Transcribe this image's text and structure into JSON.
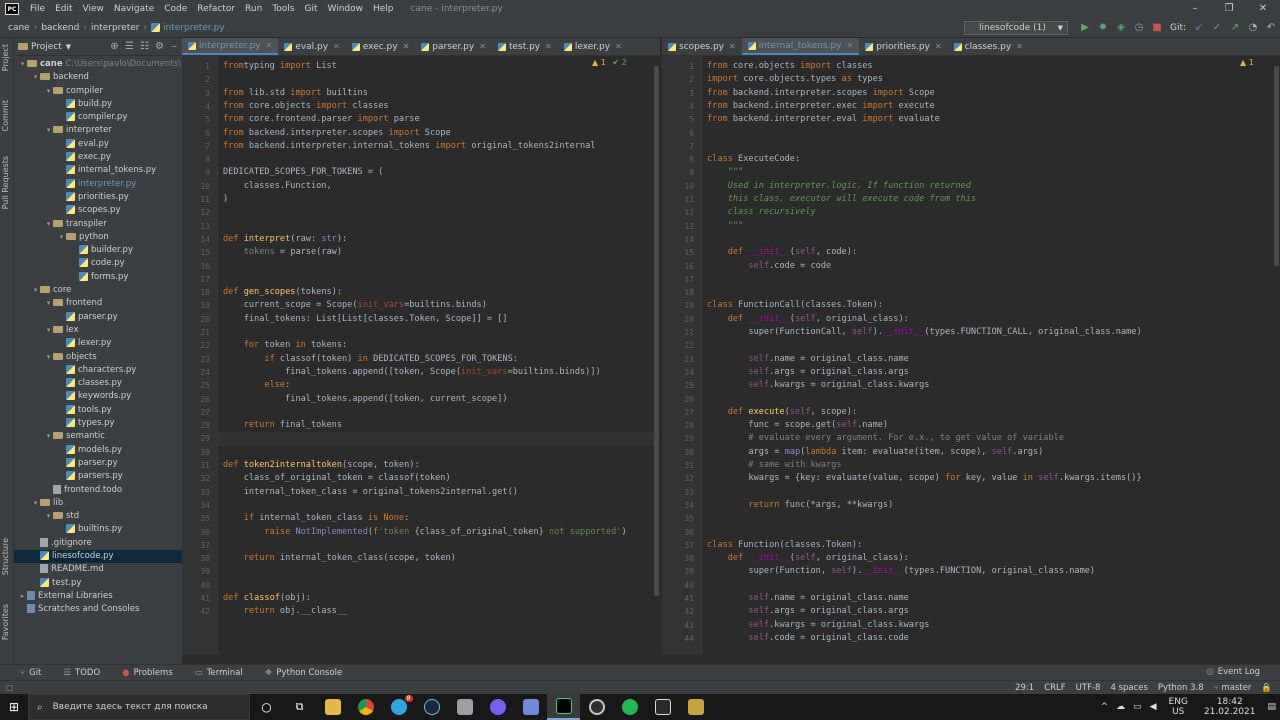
{
  "menu": {
    "items": [
      "File",
      "Edit",
      "View",
      "Navigate",
      "Code",
      "Refactor",
      "Run",
      "Tools",
      "Git",
      "Window",
      "Help"
    ],
    "title": "cane - interpreter.py"
  },
  "breadcrumb": [
    "cane",
    "backend",
    "interpreter",
    "interpreter.py"
  ],
  "run_config": "linesofcode (1)",
  "git_label": "Git:",
  "left_tabs": [
    "Project",
    "Commit",
    "Pull Requests",
    "Structure",
    "Favorites"
  ],
  "project": {
    "header": "Project",
    "tree": [
      {
        "d": 0,
        "t": "folder",
        "a": "▾",
        "n": "cane",
        "p": "C:\\Users\\pavlo\\Documents\\"
      },
      {
        "d": 1,
        "t": "folder",
        "a": "▾",
        "n": "backend"
      },
      {
        "d": 2,
        "t": "folder",
        "a": "▾",
        "n": "compiler"
      },
      {
        "d": 3,
        "t": "py",
        "n": "build.py"
      },
      {
        "d": 3,
        "t": "py",
        "n": "compiler.py"
      },
      {
        "d": 2,
        "t": "folder",
        "a": "▾",
        "n": "interpreter"
      },
      {
        "d": 3,
        "t": "py",
        "n": "eval.py"
      },
      {
        "d": 3,
        "t": "py",
        "n": "exec.py"
      },
      {
        "d": 3,
        "t": "py",
        "n": "internal_tokens.py"
      },
      {
        "d": 3,
        "t": "py",
        "n": "interpreter.py",
        "cur": true
      },
      {
        "d": 3,
        "t": "py",
        "n": "priorities.py"
      },
      {
        "d": 3,
        "t": "py",
        "n": "scopes.py"
      },
      {
        "d": 2,
        "t": "folder",
        "a": "▾",
        "n": "transpiler"
      },
      {
        "d": 3,
        "t": "folder",
        "a": "▾",
        "n": "python"
      },
      {
        "d": 4,
        "t": "py",
        "n": "builder.py"
      },
      {
        "d": 4,
        "t": "py",
        "n": "code.py"
      },
      {
        "d": 4,
        "t": "py",
        "n": "forms.py"
      },
      {
        "d": 1,
        "t": "folder",
        "a": "▾",
        "n": "core"
      },
      {
        "d": 2,
        "t": "folder",
        "a": "▾",
        "n": "frontend"
      },
      {
        "d": 3,
        "t": "py",
        "n": "parser.py"
      },
      {
        "d": 2,
        "t": "folder",
        "a": "▾",
        "n": "lex"
      },
      {
        "d": 3,
        "t": "py",
        "n": "lexer.py"
      },
      {
        "d": 2,
        "t": "folder",
        "a": "▾",
        "n": "objects"
      },
      {
        "d": 3,
        "t": "py",
        "n": "characters.py"
      },
      {
        "d": 3,
        "t": "py",
        "n": "classes.py"
      },
      {
        "d": 3,
        "t": "py",
        "n": "keywords.py"
      },
      {
        "d": 3,
        "t": "py",
        "n": "tools.py"
      },
      {
        "d": 3,
        "t": "py",
        "n": "types.py"
      },
      {
        "d": 2,
        "t": "folder",
        "a": "▾",
        "n": "semantic"
      },
      {
        "d": 3,
        "t": "py",
        "n": "models.py"
      },
      {
        "d": 3,
        "t": "py",
        "n": "parser.py"
      },
      {
        "d": 3,
        "t": "py",
        "n": "parsers.py"
      },
      {
        "d": 2,
        "t": "txt",
        "n": "frontend.todo"
      },
      {
        "d": 1,
        "t": "folder",
        "a": "▾",
        "n": "lib"
      },
      {
        "d": 2,
        "t": "folder",
        "a": "▾",
        "n": "std"
      },
      {
        "d": 3,
        "t": "py",
        "n": "builtins.py"
      },
      {
        "d": 1,
        "t": "txt",
        "n": ".gitignore"
      },
      {
        "d": 1,
        "t": "py",
        "n": "linesofcode.py",
        "sel": true
      },
      {
        "d": 1,
        "t": "txt",
        "n": "README.md"
      },
      {
        "d": 1,
        "t": "py",
        "n": "test.py"
      },
      {
        "d": 0,
        "t": "lib",
        "a": "▸",
        "n": "External Libraries"
      },
      {
        "d": 0,
        "t": "lib",
        "n": "Scratches and Consoles"
      }
    ]
  },
  "left_editor": {
    "tabs": [
      "interpreter.py",
      "eval.py",
      "exec.py",
      "parser.py",
      "test.py",
      "lexer.py"
    ],
    "inspection": [
      "▲ 1",
      "✔ 2"
    ],
    "current_line": 29,
    "lines": [
      [
        [
          "kw",
          "from"
        ],
        [
          "",
          "typing "
        ],
        [
          "kw",
          "import"
        ],
        [
          "",
          " List"
        ]
      ],
      [],
      [
        [
          "kw",
          "from"
        ],
        [
          "",
          " lib.std "
        ],
        [
          "kw",
          "import"
        ],
        [
          "",
          " builtins"
        ]
      ],
      [
        [
          "kw",
          "from"
        ],
        [
          "",
          " core.objects "
        ],
        [
          "kw",
          "import"
        ],
        [
          "",
          " classes"
        ]
      ],
      [
        [
          "kw",
          "from"
        ],
        [
          "",
          " core.frontend.parser "
        ],
        [
          "kw",
          "import"
        ],
        [
          "",
          " parse"
        ]
      ],
      [
        [
          "kw",
          "from"
        ],
        [
          "",
          " backend.interpreter.scopes "
        ],
        [
          "kw",
          "import"
        ],
        [
          "",
          " Scope"
        ]
      ],
      [
        [
          "kw",
          "from"
        ],
        [
          "",
          " backend.interpreter.internal_tokens "
        ],
        [
          "kw",
          "import"
        ],
        [
          "",
          " original_tokens2internal"
        ]
      ],
      [],
      [
        [
          "",
          "DEDICATED_SCOPES_FOR_TOKENS = ("
        ]
      ],
      [
        [
          "",
          "    classes.Function,"
        ]
      ],
      [
        [
          "",
          ")"
        ]
      ],
      [],
      [],
      [
        [
          "kw",
          "def"
        ],
        [
          "fn",
          " interpret"
        ],
        [
          "",
          "(raw: "
        ],
        [
          "bi",
          "str"
        ],
        [
          "",
          "):"
        ]
      ],
      [
        [
          "cm",
          "    tokens"
        ],
        [
          "",
          " = parse(raw)"
        ]
      ],
      [],
      [],
      [
        [
          "kw",
          "def"
        ],
        [
          "fn",
          " gen_scopes"
        ],
        [
          "",
          "(tokens):"
        ]
      ],
      [
        [
          "",
          "    current_scope = Scope("
        ],
        [
          "pr",
          "init_vars"
        ],
        [
          "",
          "=builtins.binds)"
        ]
      ],
      [
        [
          "",
          "    final_tokens: List[List[classes.Token, Scope]] = []"
        ]
      ],
      [],
      [
        [
          "kw",
          "    for"
        ],
        [
          "",
          " token "
        ],
        [
          "kw",
          "in"
        ],
        [
          "",
          " tokens:"
        ]
      ],
      [
        [
          "kw",
          "        if"
        ],
        [
          "",
          " classof(token) "
        ],
        [
          "kw",
          "in"
        ],
        [
          "",
          " DEDICATED_SCOPES_FOR_TOKENS:"
        ]
      ],
      [
        [
          "",
          "            final_tokens.append([token, Scope("
        ],
        [
          "pr",
          "init_vars"
        ],
        [
          "",
          "=builtins.binds)])"
        ]
      ],
      [
        [
          "kw",
          "        else"
        ],
        [
          "",
          ":"
        ]
      ],
      [
        [
          "",
          "            final_tokens.append([token, current_scope])"
        ]
      ],
      [],
      [
        [
          "kw",
          "    return"
        ],
        [
          "",
          " final_tokens"
        ]
      ],
      [],
      [],
      [
        [
          "kw",
          "def"
        ],
        [
          "fn",
          " token2internaltoken"
        ],
        [
          "",
          "(scope, token):"
        ]
      ],
      [
        [
          "",
          "    class_of_original_token = classof(token)"
        ]
      ],
      [
        [
          "",
          "    internal_token_class = original_tokens2internal.get()"
        ]
      ],
      [],
      [
        [
          "kw",
          "    if"
        ],
        [
          "",
          " internal_token_class "
        ],
        [
          "kw",
          "is"
        ],
        [
          "kw",
          " None"
        ],
        [
          "",
          ":"
        ]
      ],
      [
        [
          "kw",
          "        raise"
        ],
        [
          "bi",
          " NotImplemented"
        ],
        [
          "",
          "("
        ],
        [
          "kw",
          "f"
        ],
        [
          "st",
          "'token "
        ],
        [
          "",
          "{class_of_original_token}"
        ],
        [
          "st",
          " not supported'"
        ],
        [
          "",
          ")"
        ]
      ],
      [],
      [
        [
          "kw",
          "    return"
        ],
        [
          "",
          " internal_token_class(scope, token)"
        ]
      ],
      [],
      [],
      [
        [
          "kw",
          "def"
        ],
        [
          "fn",
          " classof"
        ],
        [
          "",
          "(obj):"
        ]
      ],
      [
        [
          "kw",
          "    return"
        ],
        [
          "",
          " obj.__class__"
        ]
      ]
    ]
  },
  "right_editor": {
    "tabs": [
      "scopes.py",
      "internal_tokens.py",
      "priorities.py",
      "classes.py"
    ],
    "inspection": [
      "▲ 1"
    ],
    "lines": [
      [
        [
          "kw",
          "from"
        ],
        [
          "",
          " core.objects "
        ],
        [
          "kw",
          "import"
        ],
        [
          "",
          " classes"
        ]
      ],
      [
        [
          "kw",
          "import"
        ],
        [
          "",
          " core.objects.types "
        ],
        [
          "kw",
          "as"
        ],
        [
          "",
          " types"
        ]
      ],
      [
        [
          "kw",
          "from"
        ],
        [
          "",
          " backend.interpreter.scopes "
        ],
        [
          "kw",
          "import"
        ],
        [
          "",
          " Scope"
        ]
      ],
      [
        [
          "kw",
          "from"
        ],
        [
          "",
          " backend.interpreter.exec "
        ],
        [
          "kw",
          "import"
        ],
        [
          "",
          " execute"
        ]
      ],
      [
        [
          "kw",
          "from"
        ],
        [
          "",
          " backend.interpreter.eval "
        ],
        [
          "kw",
          "import"
        ],
        [
          "",
          " evaluate"
        ]
      ],
      [],
      [],
      [
        [
          "kw",
          "class"
        ],
        [
          "",
          " ExecuteCode:"
        ]
      ],
      [
        [
          "dc",
          "    \"\"\""
        ]
      ],
      [
        [
          "dc",
          "    Used in interpreter.logic. If function returned"
        ]
      ],
      [
        [
          "dc",
          "    this class, executor will execute code from this"
        ]
      ],
      [
        [
          "dc",
          "    class recursively"
        ]
      ],
      [
        [
          "dc",
          "    \"\"\""
        ]
      ],
      [],
      [
        [
          "kw",
          "    def"
        ],
        [
          "mg",
          " __init__"
        ],
        [
          "",
          "("
        ],
        [
          "sf",
          "self"
        ],
        [
          "",
          ", code):"
        ]
      ],
      [
        [
          "sf",
          "        self"
        ],
        [
          "",
          ".code = code"
        ]
      ],
      [],
      [],
      [
        [
          "kw",
          "class"
        ],
        [
          "",
          " FunctionCall(classes.Token):"
        ]
      ],
      [
        [
          "kw",
          "    def"
        ],
        [
          "mg",
          " __init__"
        ],
        [
          "",
          "("
        ],
        [
          "sf",
          "self"
        ],
        [
          "",
          ", original_class):"
        ]
      ],
      [
        [
          "",
          "        super(FunctionCall, "
        ],
        [
          "sf",
          "self"
        ],
        [
          "",
          ")."
        ],
        [
          "mg",
          "__init__"
        ],
        [
          "",
          "(types.FUNCTION_CALL, original_class.name)"
        ]
      ],
      [],
      [
        [
          "sf",
          "        self"
        ],
        [
          "",
          ".name = original_class.name"
        ]
      ],
      [
        [
          "sf",
          "        self"
        ],
        [
          "",
          ".args = original_class.args"
        ]
      ],
      [
        [
          "sf",
          "        self"
        ],
        [
          "",
          ".kwargs = original_class.kwargs"
        ]
      ],
      [],
      [
        [
          "kw",
          "    def"
        ],
        [
          "fn",
          " execute"
        ],
        [
          "",
          "("
        ],
        [
          "sf",
          "self"
        ],
        [
          "",
          ", scope):"
        ]
      ],
      [
        [
          "",
          "        func = scope.get("
        ],
        [
          "sf",
          "self"
        ],
        [
          "",
          ".name)"
        ]
      ],
      [
        [
          "cm",
          "        # evaluate every argument. For e.x., to get value of variable"
        ]
      ],
      [
        [
          "",
          "        args = "
        ],
        [
          "bi",
          "map"
        ],
        [
          "",
          "("
        ],
        [
          "kw",
          "lambda"
        ],
        [
          "",
          " item: evaluate(item, scope), "
        ],
        [
          "sf",
          "self"
        ],
        [
          "",
          ".args)"
        ]
      ],
      [
        [
          "cm",
          "        # same with kwargs"
        ]
      ],
      [
        [
          "",
          "        kwargs = {key: evaluate(value, scope) "
        ],
        [
          "kw",
          "for"
        ],
        [
          "",
          " key, value "
        ],
        [
          "kw",
          "in"
        ],
        [
          "sf",
          " self"
        ],
        [
          "",
          ".kwargs.items()}"
        ]
      ],
      [],
      [
        [
          "kw",
          "        return"
        ],
        [
          "",
          " func(*args, **kwargs)"
        ]
      ],
      [],
      [],
      [
        [
          "kw",
          "class"
        ],
        [
          "",
          " Function(classes.Token):"
        ]
      ],
      [
        [
          "kw",
          "    def"
        ],
        [
          "mg",
          " __init__"
        ],
        [
          "",
          "("
        ],
        [
          "sf",
          "self"
        ],
        [
          "",
          ", original_class):"
        ]
      ],
      [
        [
          "",
          "        super(Function, "
        ],
        [
          "sf",
          "self"
        ],
        [
          "",
          ")."
        ],
        [
          "mg",
          "__init__"
        ],
        [
          "",
          "(types.FUNCTION, original_class.name)"
        ]
      ],
      [],
      [
        [
          "sf",
          "        self"
        ],
        [
          "",
          ".name = original_class.name"
        ]
      ],
      [
        [
          "sf",
          "        self"
        ],
        [
          "",
          ".args = original_class.args"
        ]
      ],
      [
        [
          "sf",
          "        self"
        ],
        [
          "",
          ".kwargs = original_class.kwargs"
        ]
      ],
      [
        [
          "sf",
          "        self"
        ],
        [
          "",
          ".code = original_class.code"
        ]
      ]
    ]
  },
  "bottom_tools": [
    "Git",
    "TODO",
    "Problems",
    "Terminal",
    "Python Console"
  ],
  "event_log": "Event Log",
  "status": [
    "29:1",
    "CRLF",
    "UTF-8",
    "4 spaces",
    "Python 3.8",
    "master"
  ],
  "taskbar": {
    "search_placeholder": "Введите здесь текст для поиска",
    "lang": "ENG",
    "region": "US",
    "time": "18:42",
    "date": "21.02.2021",
    "notif": "8"
  }
}
